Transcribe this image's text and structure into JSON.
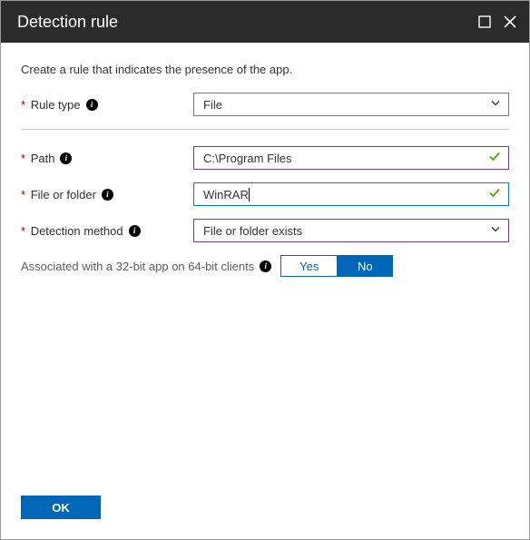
{
  "header": {
    "title": "Detection rule"
  },
  "intro": "Create a rule that indicates the presence of the app.",
  "fields": {
    "ruleType": {
      "label": "Rule type",
      "value": "File"
    },
    "path": {
      "label": "Path",
      "value": "C:\\Program Files"
    },
    "fileOrFolder": {
      "label": "File or folder",
      "value": "WinRAR"
    },
    "detectionMethod": {
      "label": "Detection method",
      "value": "File or folder exists"
    }
  },
  "toggle": {
    "label": "Associated with a 32-bit app on 64-bit clients",
    "yes": "Yes",
    "no": "No"
  },
  "footer": {
    "ok": "OK"
  }
}
